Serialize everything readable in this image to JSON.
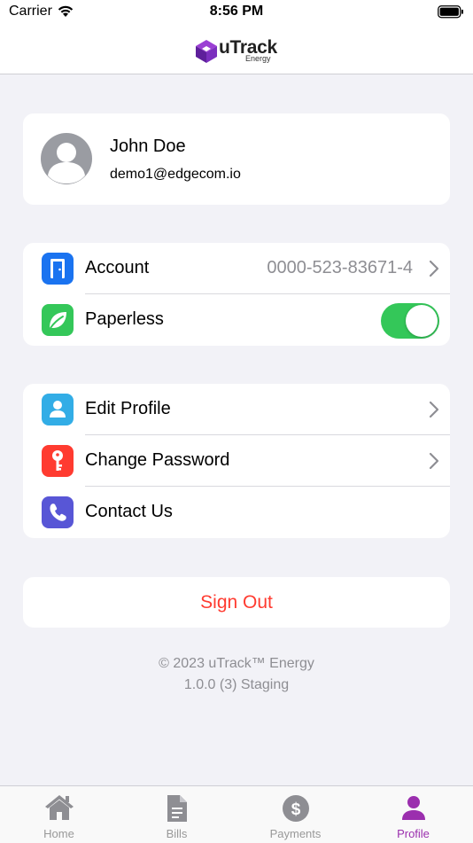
{
  "status_bar": {
    "carrier": "Carrier",
    "time": "8:56 PM"
  },
  "header": {
    "logo_text": "uTrack",
    "logo_subtext": "Energy",
    "brand_color": "#7b2fbe"
  },
  "profile": {
    "name": "John Doe",
    "email": "demo1@edgecom.io"
  },
  "account_section": {
    "account": {
      "label": "Account",
      "value": "0000-523-83671-4",
      "icon": "door-icon",
      "icon_color": "#1a73f0"
    },
    "paperless": {
      "label": "Paperless",
      "enabled": true,
      "icon": "leaf-icon",
      "icon_color": "#34c759"
    }
  },
  "settings_section": {
    "edit_profile": {
      "label": "Edit Profile",
      "icon": "person-icon",
      "icon_color": "#32ade6"
    },
    "change_password": {
      "label": "Change Password",
      "icon": "key-icon",
      "icon_color": "#ff3b30"
    },
    "contact_us": {
      "label": "Contact Us",
      "icon": "phone-icon",
      "icon_color": "#5856d6"
    }
  },
  "sign_out": {
    "label": "Sign Out",
    "color": "#ff3b30"
  },
  "footer": {
    "copyright": "© 2023 uTrack™ Energy",
    "version": "1.0.0 (3) Staging"
  },
  "tab_bar": {
    "active_color": "#9b2fae",
    "tabs": [
      {
        "label": "Home",
        "icon": "home-icon",
        "active": false
      },
      {
        "label": "Bills",
        "icon": "document-icon",
        "active": false
      },
      {
        "label": "Payments",
        "icon": "dollar-icon",
        "active": false
      },
      {
        "label": "Profile",
        "icon": "person-icon",
        "active": true
      }
    ]
  }
}
